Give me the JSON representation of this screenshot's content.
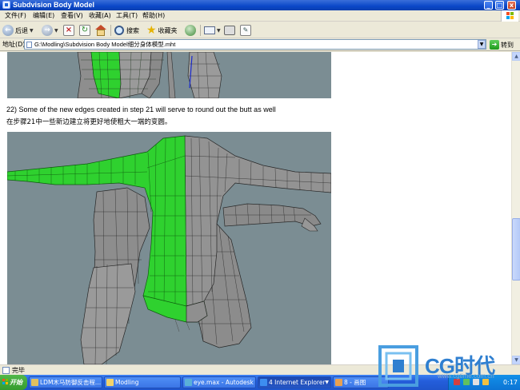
{
  "window": {
    "title": "Subdvision Body Model"
  },
  "menu": {
    "items": [
      "文件(F)",
      "编辑(E)",
      "查看(V)",
      "收藏(A)",
      "工具(T)",
      "帮助(H)"
    ]
  },
  "toolbar": {
    "back_label": "后退",
    "search_label": "搜索",
    "favorites_label": "收藏夹"
  },
  "address": {
    "label": "地址(D)",
    "value": "G:\\Modling\\Subdvision Body Model细分身体模型.mht",
    "go_label": "转到"
  },
  "content": {
    "caption_en": "22) Some of the new edges created in step 21 will serve to round out the butt as well",
    "caption_zh": "在步骤21中一些新边建立将更好地使粗大一端的变圆。"
  },
  "status": {
    "text": "完毕"
  },
  "taskbar": {
    "start_label": "开始",
    "tasks": [
      {
        "label": "LDM木马防御反击程..."
      },
      {
        "label": "Modling"
      },
      {
        "label": "eye.max - Autodesk 3..."
      },
      {
        "label": "4 Internet Explorer"
      },
      {
        "label": "8 - 画图"
      }
    ],
    "clock": "0:17"
  },
  "watermark": {
    "brand": "CG时代",
    "url": "www.cgtime.com.cn"
  },
  "colors": {
    "mesh_green": "#2fd12f",
    "mesh_grey": "#8a8a8a",
    "viewport_bg": "#7b8d93",
    "xp_blue": "#245edb"
  }
}
